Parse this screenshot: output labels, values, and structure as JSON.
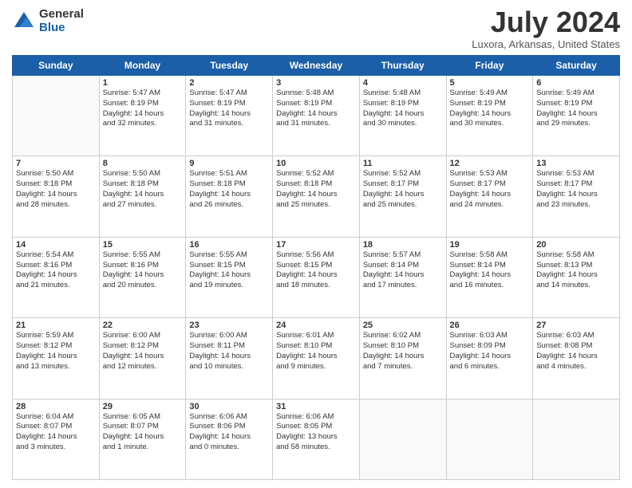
{
  "logo": {
    "general": "General",
    "blue": "Blue"
  },
  "title": "July 2024",
  "location": "Luxora, Arkansas, United States",
  "days_header": [
    "Sunday",
    "Monday",
    "Tuesday",
    "Wednesday",
    "Thursday",
    "Friday",
    "Saturday"
  ],
  "weeks": [
    [
      {
        "day": "",
        "info": ""
      },
      {
        "day": "1",
        "info": "Sunrise: 5:47 AM\nSunset: 8:19 PM\nDaylight: 14 hours\nand 32 minutes."
      },
      {
        "day": "2",
        "info": "Sunrise: 5:47 AM\nSunset: 8:19 PM\nDaylight: 14 hours\nand 31 minutes."
      },
      {
        "day": "3",
        "info": "Sunrise: 5:48 AM\nSunset: 8:19 PM\nDaylight: 14 hours\nand 31 minutes."
      },
      {
        "day": "4",
        "info": "Sunrise: 5:48 AM\nSunset: 8:19 PM\nDaylight: 14 hours\nand 30 minutes."
      },
      {
        "day": "5",
        "info": "Sunrise: 5:49 AM\nSunset: 8:19 PM\nDaylight: 14 hours\nand 30 minutes."
      },
      {
        "day": "6",
        "info": "Sunrise: 5:49 AM\nSunset: 8:19 PM\nDaylight: 14 hours\nand 29 minutes."
      }
    ],
    [
      {
        "day": "7",
        "info": "Sunrise: 5:50 AM\nSunset: 8:18 PM\nDaylight: 14 hours\nand 28 minutes."
      },
      {
        "day": "8",
        "info": "Sunrise: 5:50 AM\nSunset: 8:18 PM\nDaylight: 14 hours\nand 27 minutes."
      },
      {
        "day": "9",
        "info": "Sunrise: 5:51 AM\nSunset: 8:18 PM\nDaylight: 14 hours\nand 26 minutes."
      },
      {
        "day": "10",
        "info": "Sunrise: 5:52 AM\nSunset: 8:18 PM\nDaylight: 14 hours\nand 25 minutes."
      },
      {
        "day": "11",
        "info": "Sunrise: 5:52 AM\nSunset: 8:17 PM\nDaylight: 14 hours\nand 25 minutes."
      },
      {
        "day": "12",
        "info": "Sunrise: 5:53 AM\nSunset: 8:17 PM\nDaylight: 14 hours\nand 24 minutes."
      },
      {
        "day": "13",
        "info": "Sunrise: 5:53 AM\nSunset: 8:17 PM\nDaylight: 14 hours\nand 23 minutes."
      }
    ],
    [
      {
        "day": "14",
        "info": "Sunrise: 5:54 AM\nSunset: 8:16 PM\nDaylight: 14 hours\nand 21 minutes."
      },
      {
        "day": "15",
        "info": "Sunrise: 5:55 AM\nSunset: 8:16 PM\nDaylight: 14 hours\nand 20 minutes."
      },
      {
        "day": "16",
        "info": "Sunrise: 5:55 AM\nSunset: 8:15 PM\nDaylight: 14 hours\nand 19 minutes."
      },
      {
        "day": "17",
        "info": "Sunrise: 5:56 AM\nSunset: 8:15 PM\nDaylight: 14 hours\nand 18 minutes."
      },
      {
        "day": "18",
        "info": "Sunrise: 5:57 AM\nSunset: 8:14 PM\nDaylight: 14 hours\nand 17 minutes."
      },
      {
        "day": "19",
        "info": "Sunrise: 5:58 AM\nSunset: 8:14 PM\nDaylight: 14 hours\nand 16 minutes."
      },
      {
        "day": "20",
        "info": "Sunrise: 5:58 AM\nSunset: 8:13 PM\nDaylight: 14 hours\nand 14 minutes."
      }
    ],
    [
      {
        "day": "21",
        "info": "Sunrise: 5:59 AM\nSunset: 8:12 PM\nDaylight: 14 hours\nand 13 minutes."
      },
      {
        "day": "22",
        "info": "Sunrise: 6:00 AM\nSunset: 8:12 PM\nDaylight: 14 hours\nand 12 minutes."
      },
      {
        "day": "23",
        "info": "Sunrise: 6:00 AM\nSunset: 8:11 PM\nDaylight: 14 hours\nand 10 minutes."
      },
      {
        "day": "24",
        "info": "Sunrise: 6:01 AM\nSunset: 8:10 PM\nDaylight: 14 hours\nand 9 minutes."
      },
      {
        "day": "25",
        "info": "Sunrise: 6:02 AM\nSunset: 8:10 PM\nDaylight: 14 hours\nand 7 minutes."
      },
      {
        "day": "26",
        "info": "Sunrise: 6:03 AM\nSunset: 8:09 PM\nDaylight: 14 hours\nand 6 minutes."
      },
      {
        "day": "27",
        "info": "Sunrise: 6:03 AM\nSunset: 8:08 PM\nDaylight: 14 hours\nand 4 minutes."
      }
    ],
    [
      {
        "day": "28",
        "info": "Sunrise: 6:04 AM\nSunset: 8:07 PM\nDaylight: 14 hours\nand 3 minutes."
      },
      {
        "day": "29",
        "info": "Sunrise: 6:05 AM\nSunset: 8:07 PM\nDaylight: 14 hours\nand 1 minute."
      },
      {
        "day": "30",
        "info": "Sunrise: 6:06 AM\nSunset: 8:06 PM\nDaylight: 14 hours\nand 0 minutes."
      },
      {
        "day": "31",
        "info": "Sunrise: 6:06 AM\nSunset: 8:05 PM\nDaylight: 13 hours\nand 58 minutes."
      },
      {
        "day": "",
        "info": ""
      },
      {
        "day": "",
        "info": ""
      },
      {
        "day": "",
        "info": ""
      }
    ]
  ]
}
